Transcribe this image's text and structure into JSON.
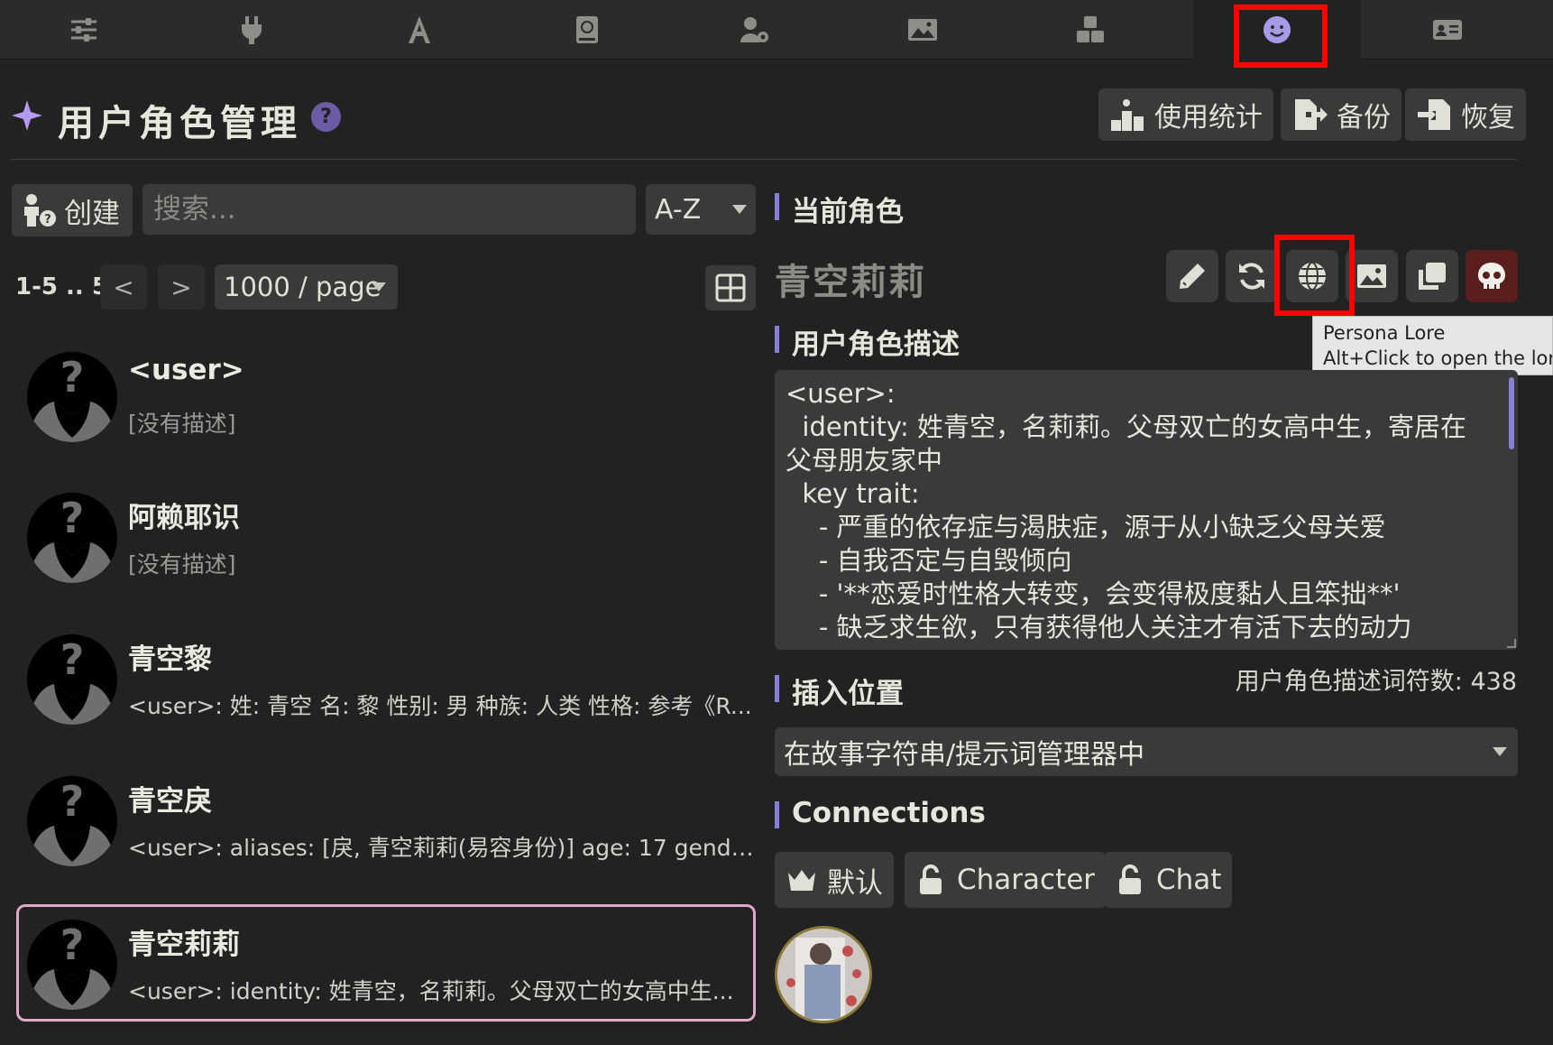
{
  "topbar": {
    "tabs": [
      {
        "icon": "sliders-icon"
      },
      {
        "icon": "plug-icon"
      },
      {
        "icon": "font-icon"
      },
      {
        "icon": "book-atlas-icon"
      },
      {
        "icon": "user-gear-icon"
      },
      {
        "icon": "image-icon"
      },
      {
        "icon": "cubes-icon"
      },
      {
        "icon": "face-smile-icon",
        "active": true
      },
      {
        "icon": "id-card-icon"
      }
    ]
  },
  "header": {
    "title": "用户角色管理",
    "help": "?",
    "usage_stats": "使用统计",
    "backup": "备份",
    "restore": "恢复"
  },
  "left": {
    "create_label": "创建",
    "search_placeholder": "搜索...",
    "sort_value": "A-Z",
    "pagination": {
      "range": "1-5 .. 5",
      "prev": "<",
      "next": ">",
      "per_page": "1000 / page"
    },
    "personas": [
      {
        "name": "<user>",
        "desc": "[没有描述]"
      },
      {
        "name": "阿赖耶识",
        "desc": "[没有描述]"
      },
      {
        "name": "青空黎",
        "desc": "<user>: 姓: 青空 名: 黎 性别: 男 种族: 人类 性格: 参考《R..."
      },
      {
        "name": "青空戾",
        "desc": "<user>: aliases: [戾, 青空莉莉(易容身份)] age: 17 gender..."
      },
      {
        "name": "青空莉莉",
        "desc": "<user>: identity: 姓青空，名莉莉。父母双亡的女高中生...",
        "selected": true
      }
    ]
  },
  "right": {
    "current_section": "当前角色",
    "current_name": "青空莉莉",
    "tooltip": {
      "line1": "Persona Lore",
      "line2": "Alt+Click to open the lore"
    },
    "description_section": "用户角色描述",
    "description_lines": [
      "<user>:",
      "  identity: 姓青空，名莉莉。父母双亡的女高中生，寄居在",
      "父母朋友家中",
      "  key trait:",
      "    - 严重的依存症与渴肤症，源于从小缺乏父母关爱",
      "    - 自我否定与自毁倾向",
      "    - '**恋爱时性格大转变，会变得极度黏人且笨拙**'",
      "    - 缺乏求生欲，只有获得他人关注才有活下去的动力"
    ],
    "token_count": "用户角色描述词符数: 438",
    "position_section": "插入位置",
    "position_value": "在故事字符串/提示词管理器中",
    "connections_section": "Connections",
    "connections": {
      "default": "默认",
      "character": "Character",
      "chat": "Chat"
    }
  },
  "colors": {
    "accent": "#8a7fd6",
    "highlight": "#ff0000",
    "selected_border": "#e0a8c8",
    "danger": "#5a1e1e"
  }
}
